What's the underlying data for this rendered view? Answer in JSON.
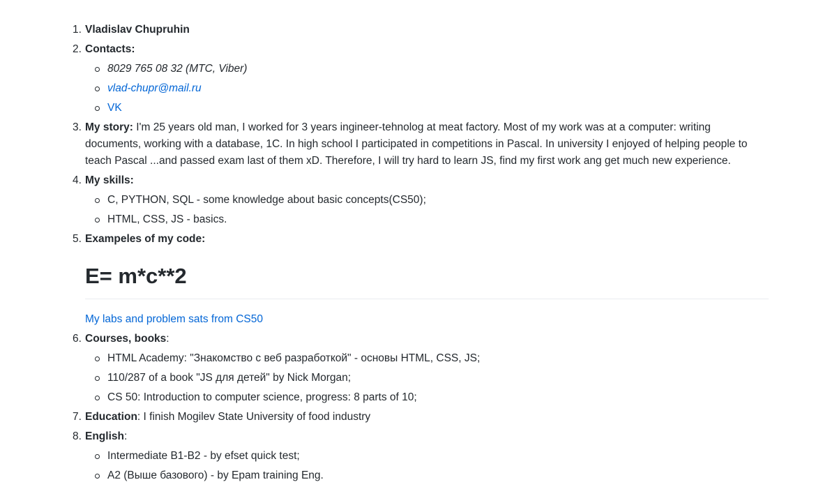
{
  "items": {
    "1": {
      "title": "Vladislav Chupruhin"
    },
    "2": {
      "title": "Contacts:",
      "phone": "8029 765 08 32 (MTC, Viber)",
      "email": "vlad-chupr@mail.ru",
      "vk": "VK"
    },
    "3": {
      "title": "My story:",
      "text": " I'm 25 years old man, I worked for 3 years ingineer-tehnolog at meat factory. Most of my work was at a computer: writing documents, working with a database, 1C. In high school I participated in competitions in Pascal. In university I enjoyed of helping people to teach Pascal ...and passed exam last of them xD. Therefore, I will try hard to learn JS, find my first work ang get much new experience."
    },
    "4": {
      "title": "My skills:",
      "skills": [
        "C, PYTHON, SQL - some knowledge about basic concepts(CS50);",
        "HTML, CSS, JS - basics."
      ]
    },
    "5": {
      "title": "Exampeles of my code:",
      "code_heading": "E= m*c**2",
      "labs_link": "My labs and problem sats from CS50"
    },
    "6": {
      "title": "Courses, books",
      "colon": ":",
      "courses": [
        "HTML Academy: \"Знакомство с веб разработкой\" - основы HTML, CSS, JS;",
        "110/287 of a book \"JS для детей\" by Nick Morgan;",
        "CS 50: Introduction to computer science, progress: 8 parts of 10;"
      ]
    },
    "7": {
      "title": "Education",
      "text": ": I finish Mogilev State University of food industry"
    },
    "8": {
      "title": "English",
      "colon": ":",
      "levels": [
        "Intermediate B1-B2 - by efset quick test;",
        "A2 (Выше базового) - by Epam training Eng."
      ]
    }
  }
}
